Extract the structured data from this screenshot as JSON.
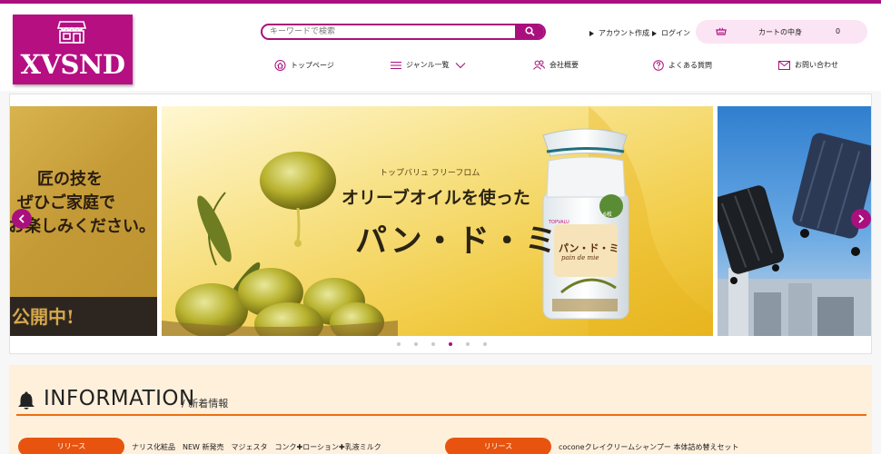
{
  "header": {
    "logo_text": "XVSND",
    "search": {
      "placeholder": "キーワードで検索"
    },
    "account_create": "アカウント作成",
    "login": "ログイン",
    "cart": {
      "label": "カートの中身",
      "count": "0"
    },
    "nav": [
      {
        "label": "トップページ"
      },
      {
        "label": "ジャンル一覧"
      },
      {
        "label": "会社概要"
      },
      {
        "label": "よくある質問"
      },
      {
        "label": "お問い合わせ"
      }
    ]
  },
  "carousel": {
    "slides": [
      {
        "lines": [
          "匠の技を",
          "ぜひご家庭で",
          "お楽しみください。"
        ],
        "footer": "公開中!"
      },
      {
        "eyebrow": "トップバリュ フリーフロム",
        "headline": "オリーブオイルを使った",
        "product": "パン・ド・ミ",
        "package_brand": "TOPVALU",
        "package_name": "パン・ド・ミ",
        "package_sub": "pain de mie",
        "package_badge": "6枚"
      },
      {}
    ],
    "dot_count": 6,
    "active_dot": 4
  },
  "information": {
    "title_en": "INFORMATION",
    "title_jp": "/ 新着情報",
    "items": [
      {
        "badge": "リリース",
        "text": "ナリス化粧品　NEW 新発売　マジェスタ　コンク✚ローション✚乳液ミルク"
      },
      {
        "badge": "リリース",
        "text": "coconeクレイクリームシャンプー 本体詰め替えセット"
      }
    ]
  },
  "colors": {
    "brand": "#a9107d",
    "accent": "#e8540f",
    "info_bg": "#fff0dc",
    "cart_bg": "#fbe4f3"
  },
  "icons": [
    "shop-icon",
    "search-icon",
    "cart-icon",
    "home-icon",
    "menu-icon",
    "chevron-down-icon",
    "users-icon",
    "question-icon",
    "mail-icon",
    "chevron-left-icon",
    "chevron-right-icon",
    "bell-icon"
  ]
}
